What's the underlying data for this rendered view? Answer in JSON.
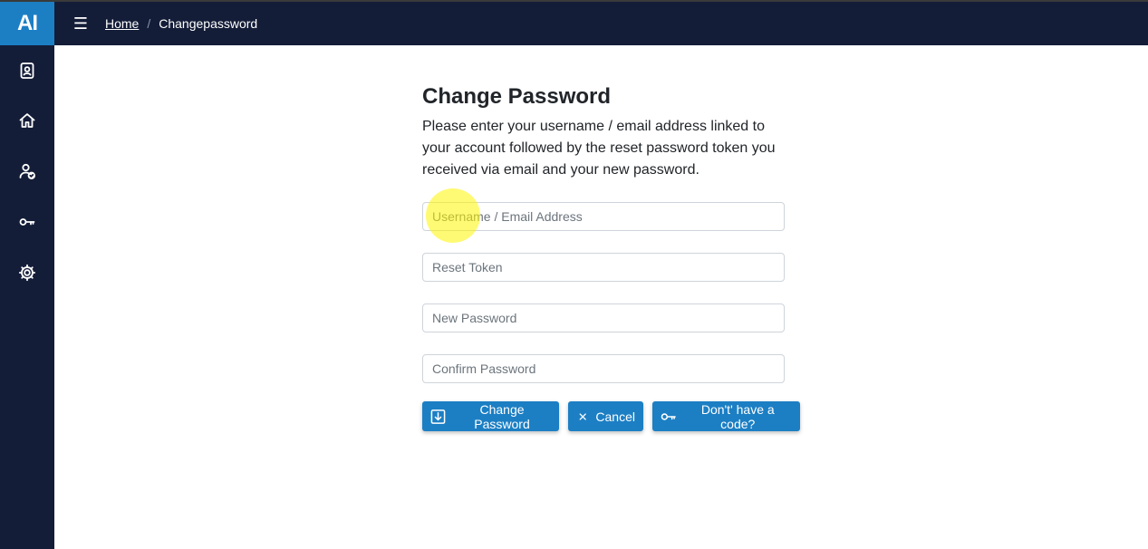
{
  "app": {
    "logo_text": "AI",
    "brand_color": "#1c7fc4",
    "nav_bg": "#141d38"
  },
  "header": {
    "menu_icon": "hamburger-menu-icon",
    "breadcrumb": {
      "home": "Home",
      "separator": "/",
      "current": "Changepassword"
    }
  },
  "sidebar": {
    "items": [
      {
        "icon": "badge-icon"
      },
      {
        "icon": "home-icon"
      },
      {
        "icon": "user-check-icon"
      },
      {
        "icon": "key-icon"
      },
      {
        "icon": "gear-icon"
      }
    ]
  },
  "form": {
    "title": "Change Password",
    "description": "Please enter your username / email address linked to your account followed by the reset password token you received via email and your new password.",
    "fields": {
      "username": {
        "placeholder": "Username / Email Address",
        "value": ""
      },
      "reset_token": {
        "placeholder": "Reset Token",
        "value": ""
      },
      "new_password": {
        "placeholder": "New Password",
        "value": ""
      },
      "confirm_password": {
        "placeholder": "Confirm Password",
        "value": ""
      }
    },
    "buttons": {
      "change_password": "Change Password",
      "cancel": "Cancel",
      "no_code": "Don't' have a code?"
    }
  }
}
